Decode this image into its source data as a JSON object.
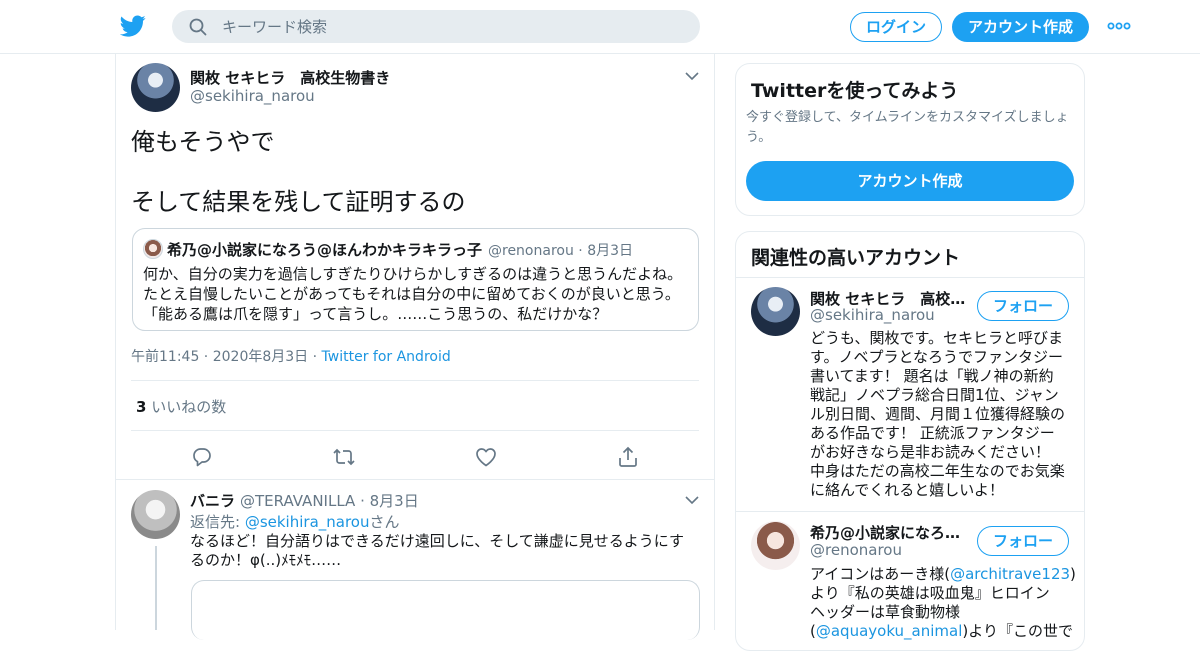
{
  "header": {
    "search_placeholder": "キーワード検索",
    "login_label": "ログイン",
    "signup_label": "アカウント作成"
  },
  "tweet": {
    "author_name": "関枚 セキヒラ　高校生物書き",
    "author_handle": "@sekihira_narou",
    "text_lines": [
      "俺もそうやで",
      "そして結果を残して証明するの"
    ],
    "quoted": {
      "author_name": "希乃@小説家になろう@ほんわかキラキラっ子",
      "author_handle": "@renonarou",
      "date": "8月3日",
      "lines": [
        "何か、自分の実力を過信しすぎたりひけらかしすぎるのは違うと思うんだよね。",
        "たとえ自慢したいことがあってもそれは自分の中に留めておくのが良いと思う。",
        "「能ある鷹は爪を隠す」って言うし。……こう思うの、私だけかな？"
      ]
    },
    "time": "午前11:45",
    "date": "2020年8月3日",
    "source": "Twitter for Android",
    "likes_count": "3",
    "likes_label": "いいねの数"
  },
  "reply": {
    "author_name": "バニラ",
    "author_handle": "@TERAVANILLA",
    "date": "8月3日",
    "replying_prefix": "返信先: ",
    "replying_handle": "@sekihira_narou",
    "replying_suffix": "さん",
    "lines": [
      "なるほど！自分語りはできるだけ遠回しに、そして謙虚に見せるようにす",
      "るのか！φ(..)ﾒﾓﾒﾓ……"
    ]
  },
  "sidebar": {
    "signup_card": {
      "title": "Twitterを使ってみよう",
      "subtitle": "今すぐ登録して、タイムラインをカスタマイズしましょう。",
      "button_label": "アカウント作成"
    },
    "related": {
      "title": "関連性の高いアカウント",
      "follow_label": "フォロー",
      "accounts": [
        {
          "name": "関枚 セキヒラ　高校…",
          "handle": "@sekihira_narou",
          "bio_lines": [
            "どうも、関枚です。セキヒラと呼びま",
            "す。ノベプラとなろうでファンタジー",
            "書いてます！ 題名は「戦ノ神の新約",
            "戦記」ノベプラ総合日間1位、ジャン",
            "ル別日間、週間、月間１位獲得経験の",
            "ある作品です！ 正統派ファンタジー",
            "がお好きなら是非お読みください！",
            "中身はただの高校二年生なのでお気楽",
            "に絡んでくれると嬉しいよ！"
          ]
        },
        {
          "name": "希乃@小説家になろ…",
          "handle": "@renonarou",
          "bio_line1_prefix": "アイコンはあーき様(",
          "bio_line1_link": "@architrave123",
          "bio_line1_suffix": ")",
          "bio_line2": "より『私の英雄は吸血鬼』ヒロイン",
          "bio_line3": "ヘッダーは草食動物様",
          "bio_line4_prefix": "(",
          "bio_line4_link": "@aquayoku_animal",
          "bio_line4_suffix": ")より『この世で"
        }
      ]
    }
  },
  "colors": {
    "accent": "#1da1f2",
    "link": "#1b95e0",
    "secondary_text": "#657786",
    "border": "#e6ecf0"
  },
  "icons": [
    "twitter-bird-icon",
    "search-icon",
    "more-icon",
    "chevron-down-icon",
    "reply-icon",
    "retweet-icon",
    "like-icon",
    "share-icon"
  ]
}
